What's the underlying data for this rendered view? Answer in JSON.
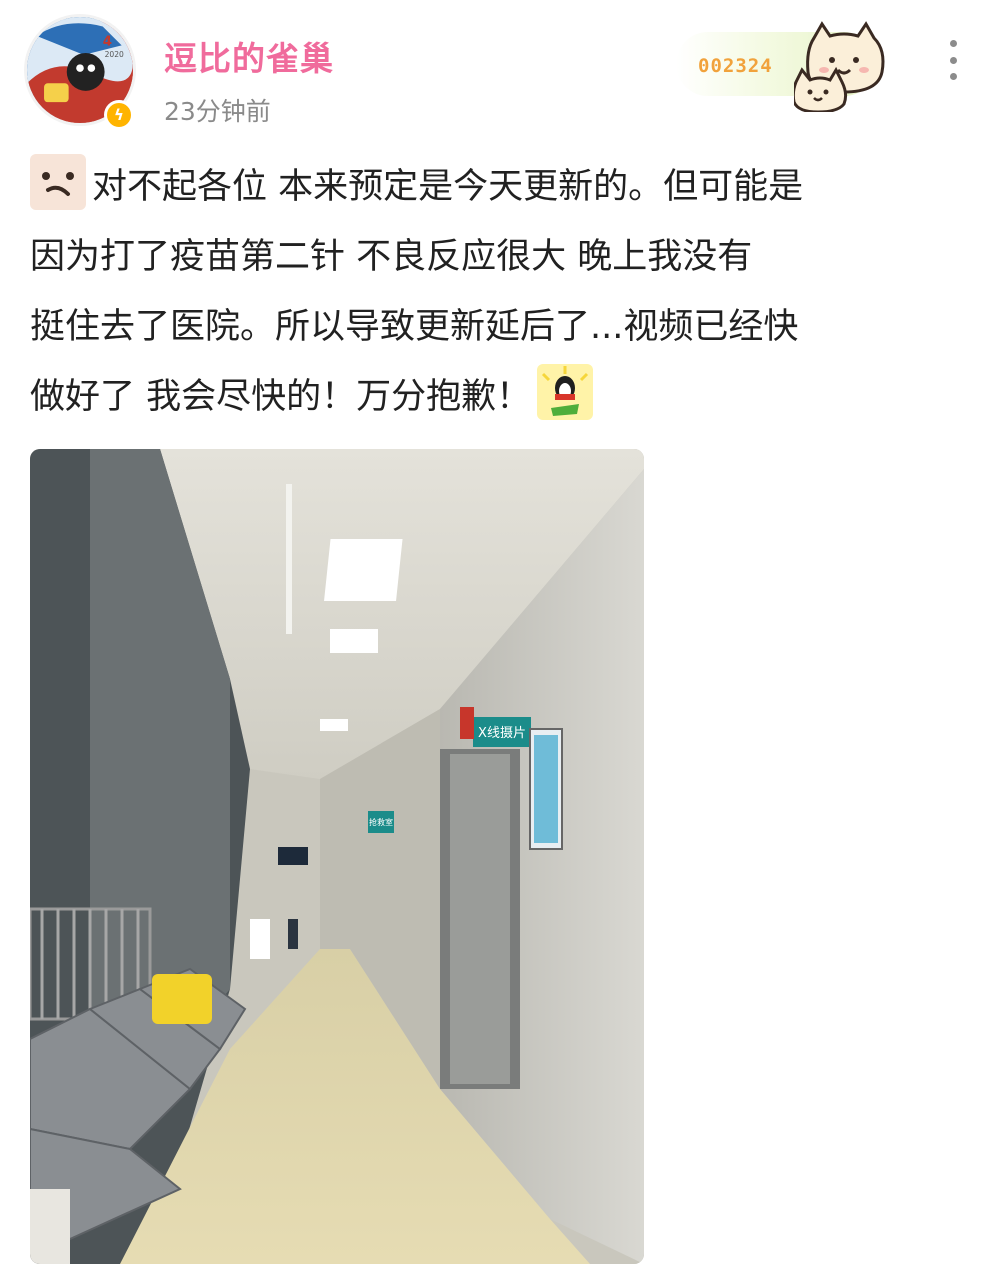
{
  "post": {
    "author": {
      "name": "逗比的雀巢",
      "avatar_icon": "avatar-image",
      "verified_icon": "lightning-badge-icon"
    },
    "timestamp": "23分钟前",
    "fan_badge": {
      "number": "002324",
      "icon": "cat-icon"
    },
    "more_icon": "more-vertical-icon",
    "body": {
      "lines": [
        "对不起各位 本来预定是今天更新的。但可能是",
        "因为打了疫苗第二针 不良反应很大 晚上我没有",
        "挺住去了医院。所以导致更新延后了...视频已经快",
        "做好了 我会尽快的！万分抱歉！"
      ],
      "emoji_start": "sorry-face-emoji",
      "emoji_end": "penguin-emoji"
    },
    "photo": {
      "sign_label": "X线摄片",
      "sign_label_small": "抢救室"
    }
  },
  "colors": {
    "username": "#f06b9c",
    "timestamp": "#8a8a8a",
    "fan_number": "#f1a23c",
    "verified": "#ffb400",
    "text": "#212121"
  }
}
